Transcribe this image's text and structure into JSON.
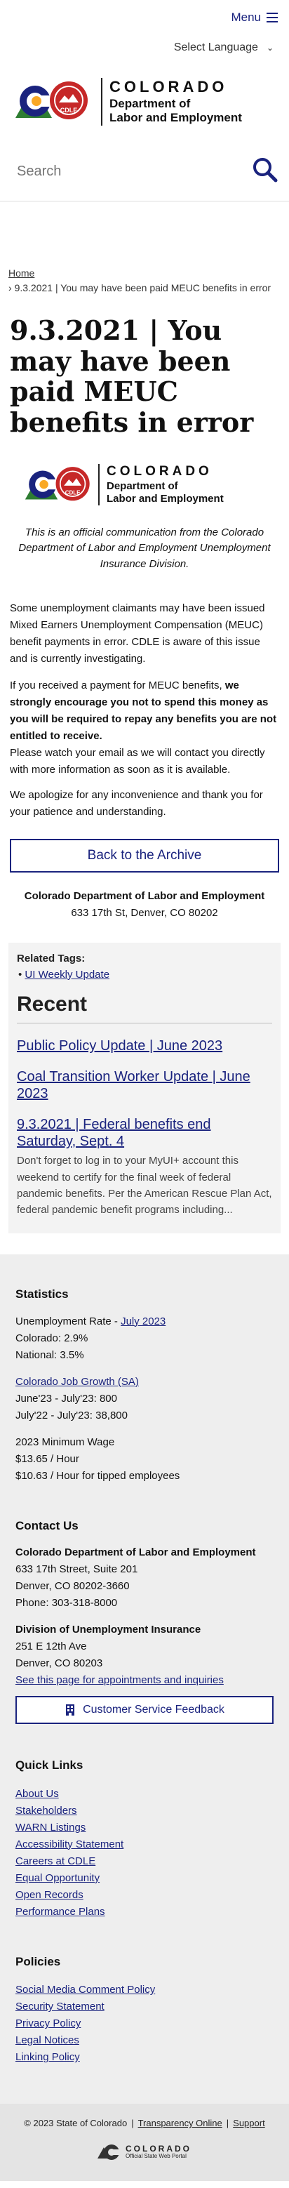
{
  "header": {
    "menu_label": "Menu",
    "language_label": "Select Language",
    "logo_state": "COLORADO",
    "logo_dept_line1": "Department of",
    "logo_dept_line2": "Labor and Employment",
    "seal_text": "CDLE"
  },
  "search": {
    "placeholder": "Search"
  },
  "breadcrumb": {
    "home": "Home",
    "current": "9.3.2021 | You may have been paid MEUC benefits in error"
  },
  "article": {
    "title": "9.3.2021 | You may have been paid MEUC benefits in error",
    "official_note": "This is an official communication from the Colorado Department of Labor and Employment Unemployment Insurance Division.",
    "para1": "Some unemployment claimants may have been issued Mixed Earners Unemployment Compensation (MEUC) benefit payments in error. CDLE is aware of this issue and is currently investigating.",
    "para2_lead": "If you received a payment for MEUC benefits, ",
    "para2_bold": "we strongly encourage you not to spend this money as you will be required to repay any benefits you are not entitled to receive.",
    "para2_tail": "Please watch your email as we will contact you directly with more information as soon as it is available.",
    "para3": "We apologize for any inconvenience and thank you for your patience and understanding.",
    "archive_button": "Back to the Archive",
    "org_name": "Colorado Department of Labor and Employment",
    "org_address": "633 17th St, Denver, CO 80202"
  },
  "sidebar": {
    "tags_heading": "Related Tags:",
    "tags": [
      "UI Weekly Update"
    ],
    "recent_heading": "Recent",
    "recent": [
      {
        "title": "Public Policy Update | June 2023",
        "excerpt": ""
      },
      {
        "title": "Coal Transition Worker Update | June 2023",
        "excerpt": ""
      },
      {
        "title": "9.3.2021 | Federal benefits end Saturday, Sept. 4",
        "excerpt": "Don't forget to log in to your MyUI+ account this weekend to certify for the final week of federal pandemic benefits. Per the American Rescue Plan Act, federal pandemic benefit programs including..."
      }
    ]
  },
  "footer": {
    "stats_heading": "Statistics",
    "unemp_label": "Unemployment Rate - ",
    "unemp_link": "July 2023",
    "unemp_co": "Colorado: 2.9%",
    "unemp_nat": "National: 3.5%",
    "job_link": "Colorado Job Growth (SA)",
    "job_1": "June'23 - July'23: 800",
    "job_2": "July'22 - July'23: 38,800",
    "wage_heading": "2023 Minimum Wage",
    "wage_1": "$13.65 / Hour",
    "wage_2": "$10.63 / Hour for tipped employees",
    "contact_heading": "Contact Us",
    "contact_org": "Colorado Department of Labor and Employment",
    "contact_street": "633 17th Street, Suite 201",
    "contact_city": "Denver, CO  80202-3660",
    "contact_phone": "Phone: 303-318-8000",
    "ui_div": "Division of Unemployment Insurance",
    "ui_street": "251 E 12th Ave",
    "ui_city": "Denver, CO  80203",
    "ui_link": "See this page for appointments and inquiries",
    "feedback_button": "Customer Service Feedback",
    "quick_heading": "Quick Links",
    "quick_links": [
      "About Us",
      "Stakeholders",
      "WARN Listings",
      "Accessibility Statement",
      "Careers at CDLE",
      "Equal Opportunity",
      "Open Records",
      "Performance Plans"
    ],
    "policies_heading": "Policies",
    "policies": [
      "Social Media Comment Policy",
      "Security Statement",
      "Privacy Policy",
      "Legal Notices",
      "Linking Policy"
    ],
    "copyright": "© 2023 State of Colorado",
    "transparency": "Transparency Online",
    "support": "Support",
    "portal_state": "COLORADO",
    "portal_sub": "Official State Web Portal",
    "colors": {
      "accent": "#1a237e",
      "seal_red": "#c62828"
    }
  }
}
